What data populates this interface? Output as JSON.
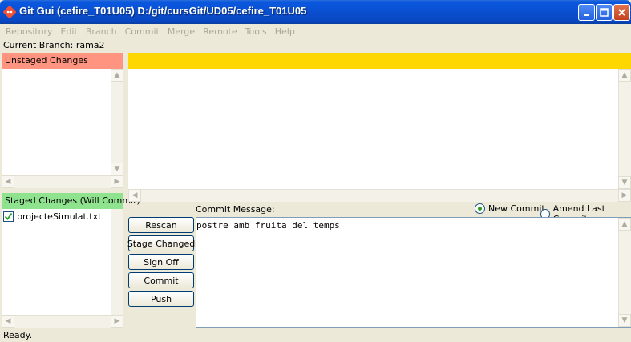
{
  "window": {
    "title": "Git Gui (cefire_T01U05) D:/git/cursGit/UD05/cefire_T01U05",
    "controls": {
      "minimize": "minimize-icon",
      "maximize": "maximize-icon",
      "close": "close-icon"
    }
  },
  "menu": [
    "Repository",
    "Edit",
    "Branch",
    "Commit",
    "Merge",
    "Remote",
    "Tools",
    "Help"
  ],
  "branch": {
    "text": "Current Branch: rama2"
  },
  "unstaged": {
    "title": "Unstaged Changes"
  },
  "staged": {
    "title": "Staged Changes (Will Commit)",
    "files": [
      {
        "name": "projecteSimulat.txt",
        "checked": true
      }
    ]
  },
  "commit": {
    "label": "Commit Message:",
    "new_commit_label": "New Commit",
    "amend_label": "Amend Last Commit",
    "selected": "new",
    "message": "postre amb fruita del temps"
  },
  "buttons": {
    "rescan": "Rescan",
    "stage_changed": "Stage Changed",
    "sign_off": "Sign Off",
    "commit": "Commit",
    "push": "Push"
  },
  "status": {
    "text": "Ready."
  },
  "colors": {
    "unstaged_header": "#ff9580",
    "staged_header": "#8fe38f",
    "diff_header": "#ffd700",
    "titlebar": "#0a4fd0"
  }
}
